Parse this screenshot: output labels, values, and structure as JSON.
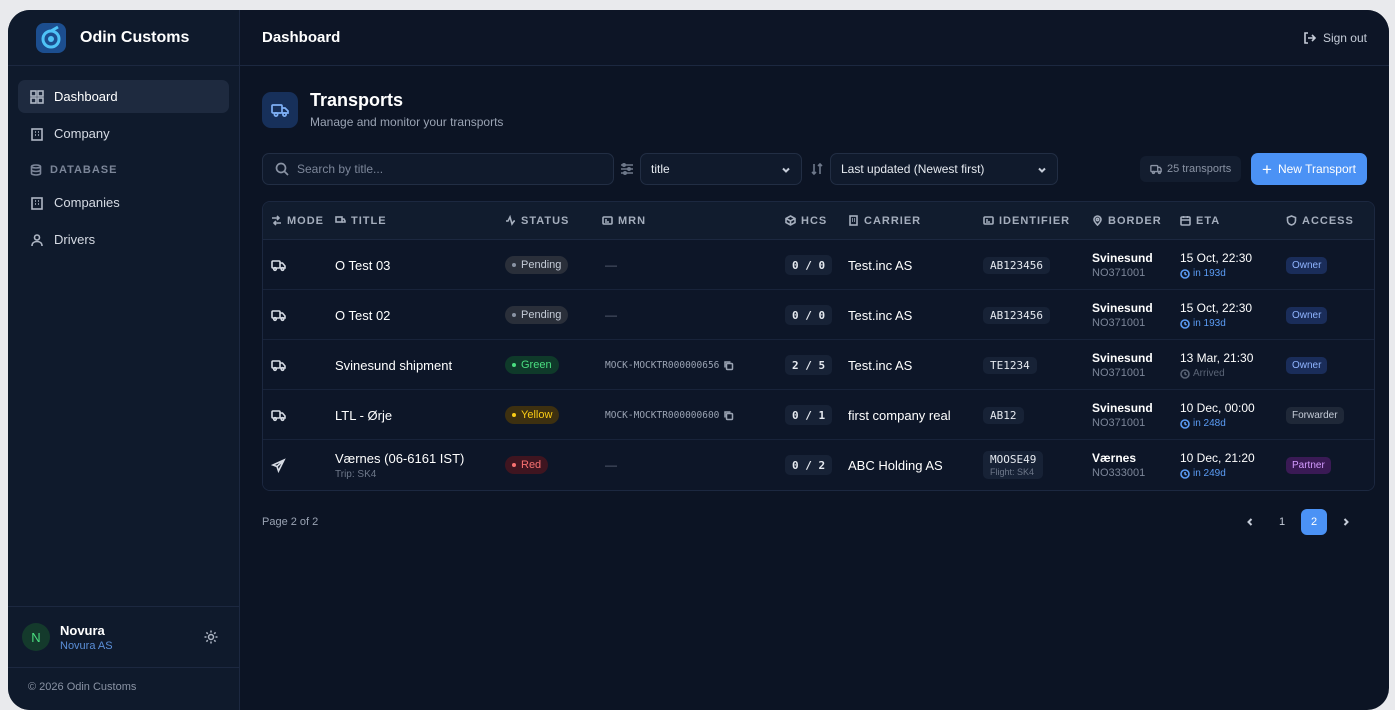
{
  "app": {
    "name": "Odin Customs",
    "copyright": "© 2026 Odin Customs"
  },
  "sidebar": {
    "items": [
      {
        "label": "Dashboard",
        "icon": "dashboard-icon"
      },
      {
        "label": "Company",
        "icon": "building-icon"
      }
    ],
    "section_label": "DATABASE",
    "db_items": [
      {
        "label": "Companies",
        "icon": "building-icon"
      },
      {
        "label": "Drivers",
        "icon": "user-icon"
      }
    ],
    "user": {
      "initial": "N",
      "name": "Novura",
      "org": "Novura AS"
    }
  },
  "topbar": {
    "title": "Dashboard",
    "signout": "Sign out"
  },
  "page": {
    "title": "Transports",
    "subtitle": "Manage and monitor your transports"
  },
  "toolbar": {
    "search_placeholder": "Search by title...",
    "filter_value": "title",
    "sort_value": "Last updated (Newest first)",
    "count": "25 transports",
    "new_button": "New Transport"
  },
  "columns": [
    "MODE",
    "TITLE",
    "STATUS",
    "MRN",
    "HCS",
    "CARRIER",
    "IDENTIFIER",
    "BORDER",
    "ETA",
    "ACCESS"
  ],
  "rows": [
    {
      "mode": "truck",
      "title": "O Test 03",
      "trip": "",
      "status": "Pending",
      "mrn": "—",
      "hcs": "0 / 0",
      "carrier": "Test.inc AS",
      "identifier": "AB123456",
      "ident_sub": "",
      "border": "Svinesund",
      "border_code": "NO371001",
      "eta": "15 Oct, 22:30",
      "eta_sub": "in 193d",
      "access": "Owner"
    },
    {
      "mode": "truck",
      "title": "O Test 02",
      "trip": "",
      "status": "Pending",
      "mrn": "—",
      "hcs": "0 / 0",
      "carrier": "Test.inc AS",
      "identifier": "AB123456",
      "ident_sub": "",
      "border": "Svinesund",
      "border_code": "NO371001",
      "eta": "15 Oct, 22:30",
      "eta_sub": "in 193d",
      "access": "Owner"
    },
    {
      "mode": "truck",
      "title": "Svinesund shipment",
      "trip": "",
      "status": "Green",
      "mrn": "MOCK-MOCKTR000000656",
      "hcs": "2 / 5",
      "carrier": "Test.inc AS",
      "identifier": "TE1234",
      "ident_sub": "",
      "border": "Svinesund",
      "border_code": "NO371001",
      "eta": "13 Mar, 21:30",
      "eta_sub": "Arrived",
      "access": "Owner"
    },
    {
      "mode": "truck",
      "title": "LTL - Ørje",
      "trip": "",
      "status": "Yellow",
      "mrn": "MOCK-MOCKTR000000600",
      "hcs": "0 / 1",
      "carrier": "first company real",
      "identifier": "AB12",
      "ident_sub": "",
      "border": "Svinesund",
      "border_code": "NO371001",
      "eta": "10 Dec, 00:00",
      "eta_sub": "in 248d",
      "access": "Forwarder"
    },
    {
      "mode": "plane",
      "title": "Værnes (06-6161 IST)",
      "trip": "Trip: SK4",
      "status": "Red",
      "mrn": "—",
      "hcs": "0 / 2",
      "carrier": "ABC Holding AS",
      "identifier": "MOOSE49",
      "ident_sub": "Flight: SK4",
      "border": "Værnes",
      "border_code": "NO333001",
      "eta": "10 Dec, 21:20",
      "eta_sub": "in 249d",
      "access": "Partner"
    }
  ],
  "pagination": {
    "info": "Page 2 of 2",
    "pages": [
      "1",
      "2"
    ],
    "current": "2"
  },
  "colors": {
    "accent": "#4b92f5",
    "status": {
      "Pending": "#2a2f3a",
      "Green": "#0f3a2a",
      "Yellow": "#3d3010",
      "Red": "#3f1520"
    }
  }
}
